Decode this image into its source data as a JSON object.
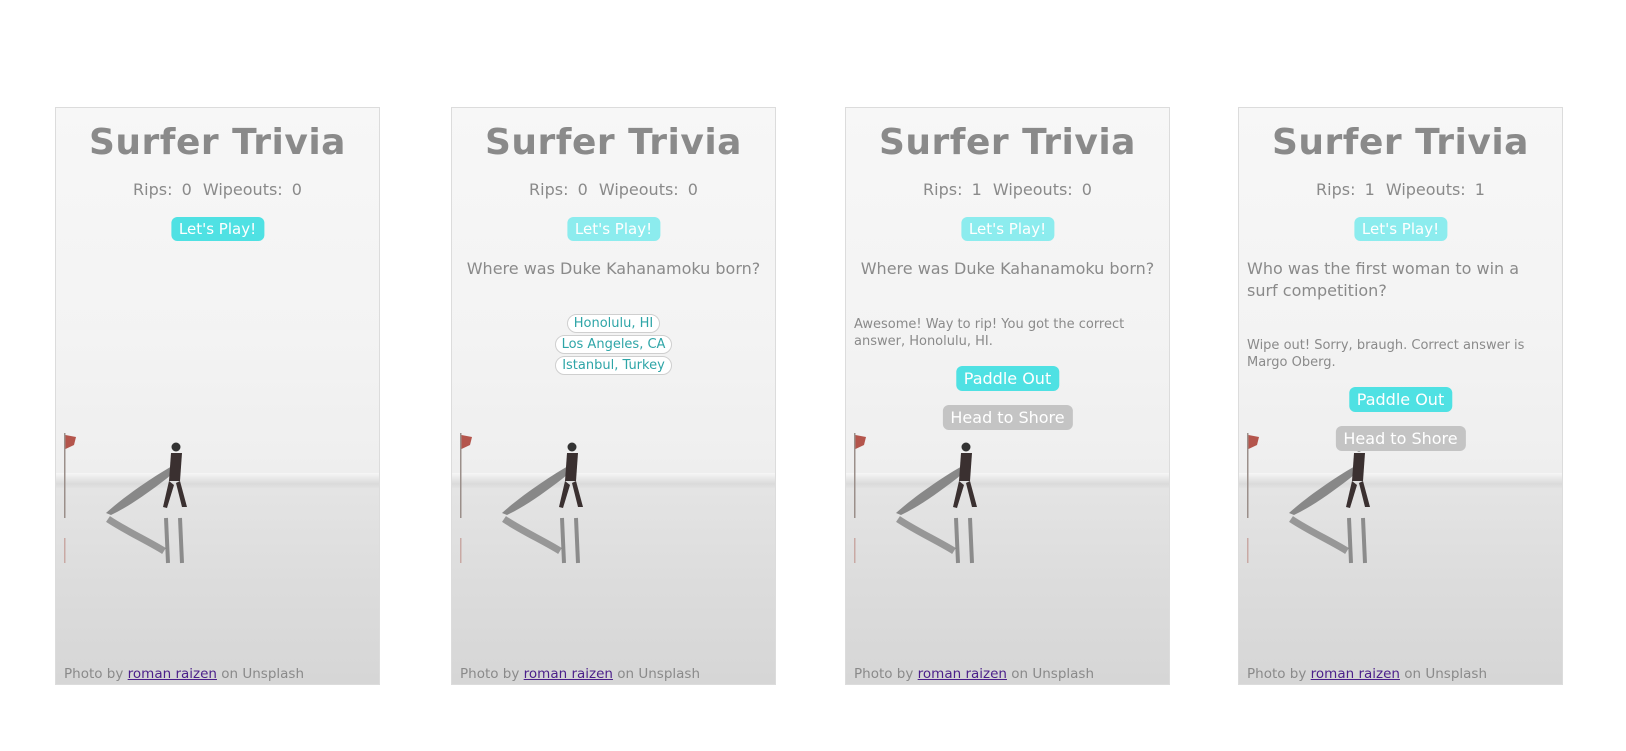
{
  "app": {
    "title": "Surfer Trivia"
  },
  "labels": {
    "rips": "Rips:",
    "wipeouts": "Wipeouts:",
    "play": "Let's Play!",
    "paddle_out": "Paddle Out",
    "head_to_shore": "Head to Shore",
    "credit_prefix": "Photo by",
    "credit_author": "roman raizen",
    "credit_suffix": "on Unsplash"
  },
  "screens": [
    {
      "rips": "0",
      "wipeouts": "0"
    },
    {
      "rips": "0",
      "wipeouts": "0",
      "question": "Where was Duke Kahanamoku born?",
      "answers": [
        "Honolulu, HI",
        "Los Angeles, CA",
        "Istanbul, Turkey"
      ]
    },
    {
      "rips": "1",
      "wipeouts": "0",
      "question": "Where was Duke Kahanamoku born?",
      "feedback": "Awesome! Way to rip! You got the correct answer, Honolulu, HI."
    },
    {
      "rips": "1",
      "wipeouts": "1",
      "question": "Who was the first woman to win a surf competition?",
      "feedback": "Wipe out! Sorry, braugh. Correct answer is Margo Oberg."
    }
  ],
  "colors": {
    "accent": "#4fe1e3",
    "secondary": "#c4c4c4",
    "text": "#8a8a8a",
    "link": "#4b1f8a"
  }
}
